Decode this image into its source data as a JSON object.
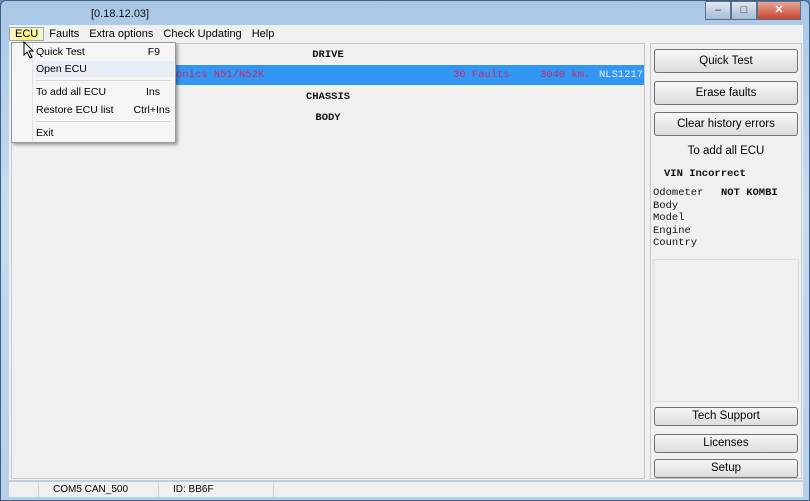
{
  "window": {
    "title": "[0.18.12.03]",
    "minimize": "–",
    "maximize": "□",
    "close": "✕"
  },
  "menubar": [
    "ECU",
    "Faults",
    "Extra options",
    "Check Updating",
    "Help"
  ],
  "ecu_menu": {
    "items": [
      {
        "label": "Quick Test",
        "shortcut": "F9"
      },
      {
        "label": "Open ECU",
        "shortcut": ""
      },
      {
        "label": "To add all ECU",
        "shortcut": "Ins"
      },
      {
        "label": "Restore ECU list",
        "shortcut": "Ctrl+Ins"
      },
      {
        "label": "Exit",
        "shortcut": ""
      }
    ]
  },
  "list": {
    "groups": [
      "DRIVE",
      "CHASSIS",
      "BODY"
    ],
    "selected_row": {
      "name": "onics N51/N52K",
      "faults": "30 Faults",
      "km": "3040 km.",
      "id": "NLS1217"
    }
  },
  "right": {
    "quick_test": "Quick Test",
    "erase": "Erase faults",
    "clear_history": "Clear history errors",
    "add_all": "To add all ECU",
    "vin": "VIN Incorrect",
    "fields": [
      "Odometer",
      "Body",
      "Model",
      "Engine",
      "Country"
    ],
    "odometer_value": "NOT KOMBI",
    "tech_support": "Tech Support",
    "licenses": "Licenses",
    "setup": "Setup"
  },
  "status": {
    "port": "COM5  CAN_500",
    "id": "ID: BB6F"
  },
  "colors": {
    "selection": "#3297f2",
    "fault_text": "#c8286e"
  }
}
